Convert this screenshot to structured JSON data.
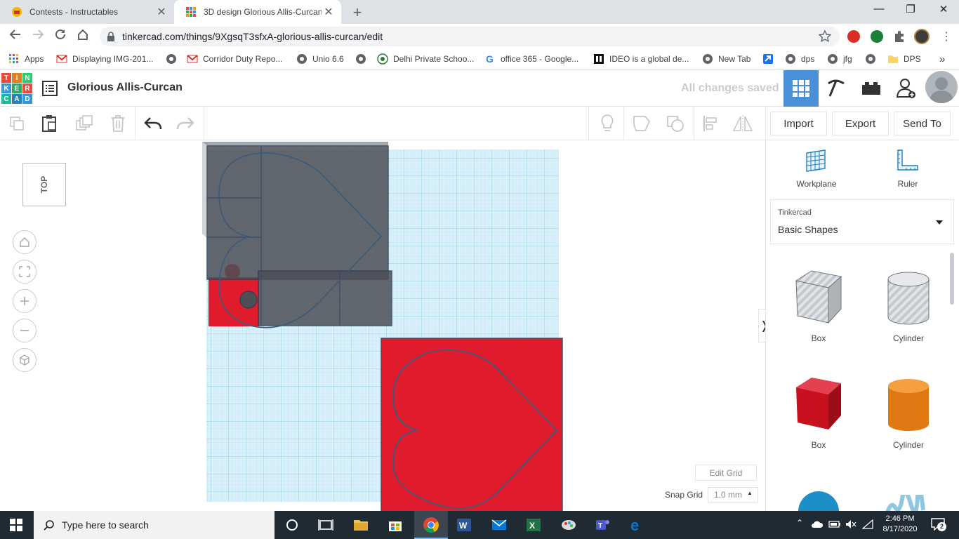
{
  "browser": {
    "tabs": [
      {
        "title": "Contests - Instructables",
        "close": "✕"
      },
      {
        "title": "3D design Glorious Allis-Curcan | ",
        "close": "✕"
      }
    ],
    "new_tab": "+",
    "window_controls": {
      "minimize": "—",
      "maximize": "❐",
      "close": "✕"
    },
    "url": "tinkercad.com/things/9XgsqT3sfxA-glorious-allis-curcan/edit",
    "bookmarks": [
      {
        "label": "Apps",
        "icon": "apps-grid-icon"
      },
      {
        "label": "Displaying IMG-201...",
        "icon": "gmail-icon"
      },
      {
        "label": "",
        "icon": "globe-icon"
      },
      {
        "label": "Corridor Duty Repo...",
        "icon": "gmail-icon"
      },
      {
        "label": "Unio 6.6",
        "icon": "globe-icon"
      },
      {
        "label": "",
        "icon": "globe-icon"
      },
      {
        "label": "Delhi Private Schoo...",
        "icon": "school-icon"
      },
      {
        "label": "office 365 - Google...",
        "icon": "google-icon"
      },
      {
        "label": "IDEO is a global de...",
        "icon": "ideo-icon"
      },
      {
        "label": "New Tab",
        "icon": "globe-icon"
      },
      {
        "label": "",
        "icon": "arrow-icon"
      },
      {
        "label": "dps",
        "icon": "globe-icon"
      },
      {
        "label": "jfg",
        "icon": "globe-icon"
      },
      {
        "label": "",
        "icon": "globe-icon"
      },
      {
        "label": "DPS",
        "icon": "folder-icon"
      }
    ],
    "bookmarks_overflow": "»"
  },
  "tinkercad": {
    "logo_letters": [
      "T",
      "I",
      "N",
      "K",
      "E",
      "R",
      "C",
      "A",
      "D"
    ],
    "design_name": "Glorious Allis-Curcan",
    "save_status": "All changes saved",
    "toolbar": {
      "import": "Import",
      "export": "Export",
      "send_to": "Send To"
    },
    "view_cube_label": "TOP",
    "side_panel": {
      "workplane": "Workplane",
      "ruler": "Ruler",
      "library_source": "Tinkercad",
      "library_name": "Basic Shapes",
      "shapes": [
        {
          "label": "Box",
          "style": "hole"
        },
        {
          "label": "Cylinder",
          "style": "hole"
        },
        {
          "label": "Box",
          "style": "solid"
        },
        {
          "label": "Cylinder",
          "style": "solid"
        }
      ],
      "collapse_arrow": "❭"
    },
    "grid_controls": {
      "edit_grid": "Edit Grid",
      "snap_grid_label": "Snap Grid",
      "snap_grid_value": "1.0 mm"
    },
    "colors": {
      "red": "#e01c2c",
      "grid": "#a6dbee",
      "hole": "#555a63",
      "accent_blue": "#4a90d9"
    }
  },
  "taskbar": {
    "search_placeholder": "Type here to search",
    "time": "2:46 PM",
    "date": "8/17/2020",
    "notifications": "2"
  }
}
